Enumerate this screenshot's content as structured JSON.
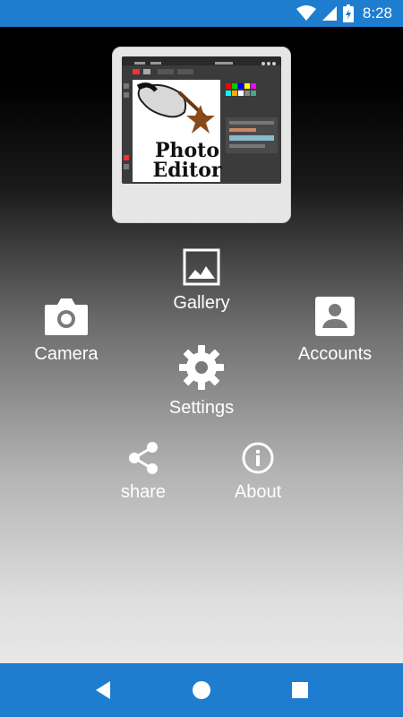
{
  "status_bar": {
    "time": "8:28",
    "icons": [
      "wifi-icon",
      "cell-signal-icon",
      "battery-charging-icon"
    ]
  },
  "logo": {
    "text_line1": "Photo",
    "text_line2": "Editor"
  },
  "menu": {
    "gallery": {
      "label": "Gallery",
      "icon": "image-icon"
    },
    "camera": {
      "label": "Camera",
      "icon": "camera-icon"
    },
    "accounts": {
      "label": "Accounts",
      "icon": "account-box-icon"
    },
    "settings": {
      "label": "Settings",
      "icon": "gear-icon"
    },
    "share": {
      "label": "share",
      "icon": "share-icon"
    },
    "about": {
      "label": "About",
      "icon": "info-icon"
    }
  },
  "nav_bar": {
    "buttons": [
      "back-icon",
      "home-icon",
      "recents-icon"
    ]
  },
  "colors": {
    "bar_blue": "#1f7dd0",
    "icon_white": "#ffffff"
  }
}
